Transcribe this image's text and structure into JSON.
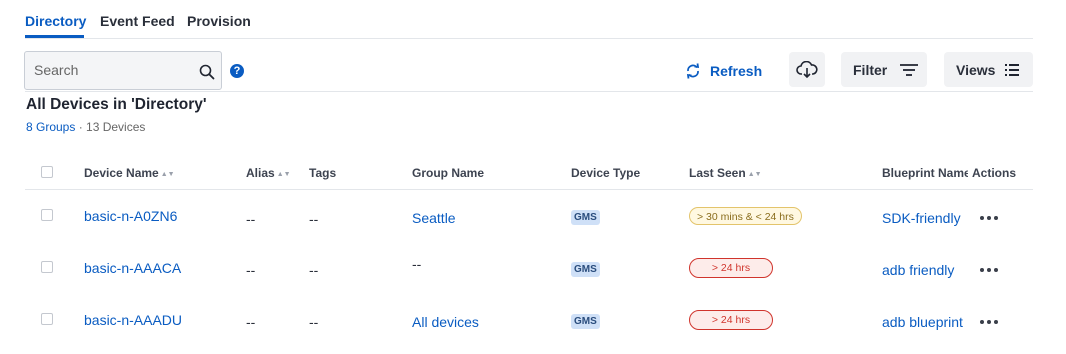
{
  "tabs": [
    "Directory",
    "Event Feed",
    "Provision"
  ],
  "search": {
    "placeholder": "Search"
  },
  "help": "?",
  "toolbar": {
    "refresh": "Refresh",
    "filter": "Filter",
    "views": "Views"
  },
  "heading": {
    "title": "All Devices in 'Directory'",
    "groups": "8 Groups",
    "sep": " · ",
    "devices": "13 Devices"
  },
  "columns": [
    "Device Name",
    "Alias",
    "Tags",
    "Group Name",
    "Device Type",
    "Last Seen",
    "Blueprint Name",
    "Actions"
  ],
  "rows": [
    {
      "device": "basic-n-A0ZN6",
      "alias": "--",
      "tags": "--",
      "group": "Seattle",
      "type": "GMS",
      "last_seen": "> 30 mins & < 24 hrs",
      "last_seen_status": "warning",
      "blueprint": "SDK-friendly"
    },
    {
      "device": "basic-n-AAACA",
      "alias": "--",
      "tags": "--",
      "group": "--",
      "type": "GMS",
      "last_seen": "> 24 hrs",
      "last_seen_status": "danger",
      "blueprint": "adb friendly"
    },
    {
      "device": "basic-n-AAADU",
      "alias": "--",
      "tags": "--",
      "group": "All devices",
      "type": "GMS",
      "last_seen": "> 24 hrs",
      "last_seen_status": "danger",
      "blueprint": "adb blueprint"
    }
  ],
  "colors": {
    "accent": "#0a5cc2",
    "warning": "#e3c46b",
    "danger": "#d0342c"
  }
}
